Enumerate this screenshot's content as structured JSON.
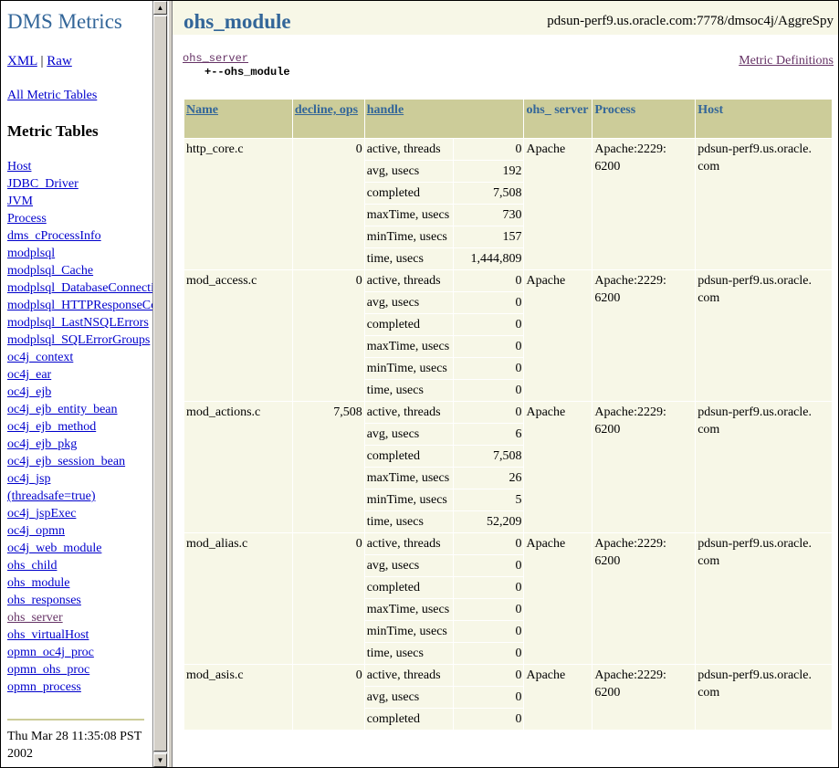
{
  "left": {
    "title": "DMS Metrics",
    "xml_label": "XML",
    "sep": "|",
    "raw_label": "Raw",
    "all_tables_label": "All Metric Tables",
    "metric_tables_heading": "Metric Tables",
    "tables": [
      "Host",
      "JDBC_Driver",
      "JVM",
      "Process",
      "dms_cProcessInfo",
      "modplsql",
      "modplsql_Cache",
      "modplsql_DatabaseConnection",
      "modplsql_HTTPResponseCodes",
      "modplsql_LastNSQLErrors",
      "modplsql_SQLErrorGroups",
      "oc4j_context",
      "oc4j_ear",
      "oc4j_ejb",
      "oc4j_ejb_entity_bean",
      "oc4j_ejb_method",
      "oc4j_ejb_pkg",
      "oc4j_ejb_session_bean",
      "oc4j_jsp",
      "(threadsafe=true)",
      "oc4j_jspExec",
      "oc4j_opmn",
      "oc4j_web_module",
      "ohs_child",
      "ohs_module",
      "ohs_responses",
      "ohs_server",
      "ohs_virtualHost",
      "opmn_oc4j_proc",
      "opmn_ohs_proc",
      "opmn_process"
    ],
    "visited_table": "ohs_server",
    "timestamp": "Thu Mar 28 11:35:08 PST 2002"
  },
  "right": {
    "module_title": "ohs_module",
    "url": "pdsun-perf9.us.oracle.com:7778/dmsoc4j/AggreSpy",
    "tree_parent": "ohs_server",
    "tree_child": "+--ohs_module",
    "metric_definitions": "Metric Definitions",
    "columns": [
      "Name",
      "decline, ops",
      "handle",
      "ohs_ server",
      "Process",
      "Host"
    ],
    "rows": [
      {
        "name": "http_core.c",
        "decline": "0",
        "handle": [
          [
            "active, threads",
            "0"
          ],
          [
            "avg, usecs",
            "192"
          ],
          [
            "completed",
            "7,508"
          ],
          [
            "maxTime, usecs",
            "730"
          ],
          [
            "minTime, usecs",
            "157"
          ],
          [
            "time, usecs",
            "1,444,809"
          ]
        ],
        "server": "Apache",
        "process": "Apache:2229: 6200",
        "host": "pdsun-perf9.us.oracle. com"
      },
      {
        "name": "mod_access.c",
        "decline": "0",
        "handle": [
          [
            "active, threads",
            "0"
          ],
          [
            "avg, usecs",
            "0"
          ],
          [
            "completed",
            "0"
          ],
          [
            "maxTime, usecs",
            "0"
          ],
          [
            "minTime, usecs",
            "0"
          ],
          [
            "time, usecs",
            "0"
          ]
        ],
        "server": "Apache",
        "process": "Apache:2229: 6200",
        "host": "pdsun-perf9.us.oracle. com"
      },
      {
        "name": "mod_actions.c",
        "decline": "7,508",
        "handle": [
          [
            "active, threads",
            "0"
          ],
          [
            "avg, usecs",
            "6"
          ],
          [
            "completed",
            "7,508"
          ],
          [
            "maxTime, usecs",
            "26"
          ],
          [
            "minTime, usecs",
            "5"
          ],
          [
            "time, usecs",
            "52,209"
          ]
        ],
        "server": "Apache",
        "process": "Apache:2229: 6200",
        "host": "pdsun-perf9.us.oracle. com"
      },
      {
        "name": "mod_alias.c",
        "decline": "0",
        "handle": [
          [
            "active, threads",
            "0"
          ],
          [
            "avg, usecs",
            "0"
          ],
          [
            "completed",
            "0"
          ],
          [
            "maxTime, usecs",
            "0"
          ],
          [
            "minTime, usecs",
            "0"
          ],
          [
            "time, usecs",
            "0"
          ]
        ],
        "server": "Apache",
        "process": "Apache:2229: 6200",
        "host": "pdsun-perf9.us.oracle. com"
      },
      {
        "name": "mod_asis.c",
        "decline": "0",
        "handle": [
          [
            "active, threads",
            "0"
          ],
          [
            "avg, usecs",
            "0"
          ],
          [
            "completed",
            "0"
          ]
        ],
        "server": "Apache",
        "process": "Apache:2229: 6200",
        "host": "pdsun-perf9.us.oracle. com"
      }
    ]
  },
  "colors": {
    "title": "#336699",
    "header_bg": "#cccc99",
    "cell_bg": "#f7f7e7",
    "link": "#0000cc",
    "visited": "#663366"
  }
}
